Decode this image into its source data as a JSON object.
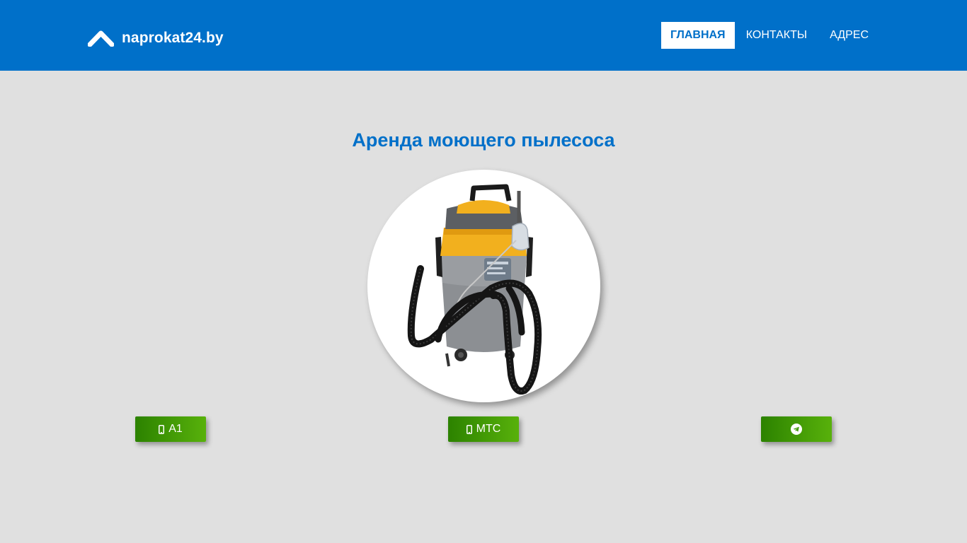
{
  "header": {
    "brand": {
      "text": "naprokat24.by",
      "icon": "chevron-up-icon"
    },
    "nav": [
      {
        "label": "ГЛАВНАЯ",
        "active": true
      },
      {
        "label": "КОНТАКТЫ",
        "active": false
      },
      {
        "label": "АДРЕС",
        "active": false
      }
    ]
  },
  "main": {
    "title": "Аренда моющего пылесоса",
    "image": {
      "subject": "washing vacuum cleaner"
    },
    "buttons": [
      {
        "label": "A1",
        "icon": "mobile-phone-icon"
      },
      {
        "label": "МТС",
        "icon": "mobile-phone-icon"
      },
      {
        "label": "",
        "icon": "telegram-icon"
      }
    ]
  },
  "colors": {
    "primary": "#0070c9",
    "background": "#e0e0e0",
    "button_green_start": "#2c8200",
    "button_green_end": "#58b10b"
  }
}
